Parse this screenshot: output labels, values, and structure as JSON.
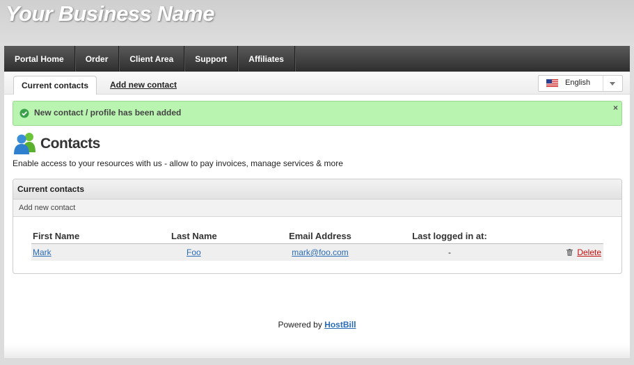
{
  "header": {
    "brand": "Your Business Name"
  },
  "nav": {
    "items": [
      "Portal Home",
      "Order",
      "Client Area",
      "Support",
      "Affiliates"
    ]
  },
  "tabs": {
    "active": "Current contacts",
    "link": "Add new contact"
  },
  "language": {
    "selected": "English",
    "flag_icon": "us-flag-icon"
  },
  "alert": {
    "message": "New contact / profile has been added",
    "close": "×"
  },
  "page": {
    "title": "Contacts",
    "description": "Enable access to your resources with us - allow to pay invoices, manage services & more"
  },
  "panel": {
    "title": "Current contacts",
    "sub_link": "Add new contact",
    "table": {
      "headers": [
        "First Name",
        "Last Name",
        "Email Address",
        "Last logged in at:"
      ],
      "rows": [
        {
          "first": "Mark",
          "last": "Foo",
          "email": "mark@foo.com",
          "last_login": "-",
          "action": "Delete"
        }
      ]
    }
  },
  "footer": {
    "prefix": "Powered by",
    "link": "HostBill"
  },
  "colors": {
    "alert_bg": "#b9f5b0",
    "link": "#2a6bb5",
    "delete": "#c21010",
    "nav_bg": "#3a3a3a"
  }
}
